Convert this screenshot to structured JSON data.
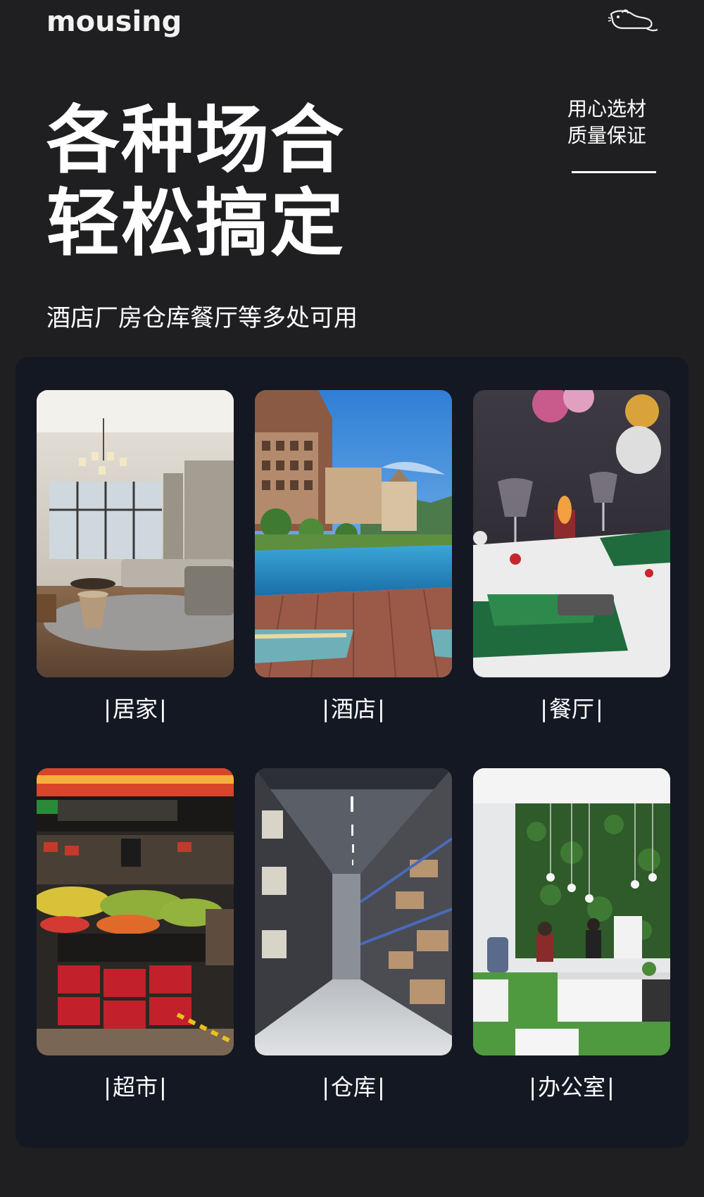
{
  "header": {
    "brand": "mousing",
    "logo_icon": "mouse-icon"
  },
  "hero": {
    "title_lines": [
      "各种场合",
      "轻松搞定"
    ],
    "quality_lines": [
      "用心选材",
      "质量保证"
    ],
    "subtitle": "酒店厂房仓库餐厅等多处可用"
  },
  "scenes": [
    {
      "label": "居家",
      "icon": "living-room-photo"
    },
    {
      "label": "酒店",
      "icon": "hotel-pool-photo"
    },
    {
      "label": "餐厅",
      "icon": "restaurant-table-photo"
    },
    {
      "label": "超市",
      "icon": "supermarket-photo"
    },
    {
      "label": "仓库",
      "icon": "warehouse-photo"
    },
    {
      "label": "办公室",
      "icon": "office-photo"
    }
  ],
  "colors": {
    "background": "#1f1f22",
    "panel": "#141823",
    "text": "#ffffff"
  }
}
